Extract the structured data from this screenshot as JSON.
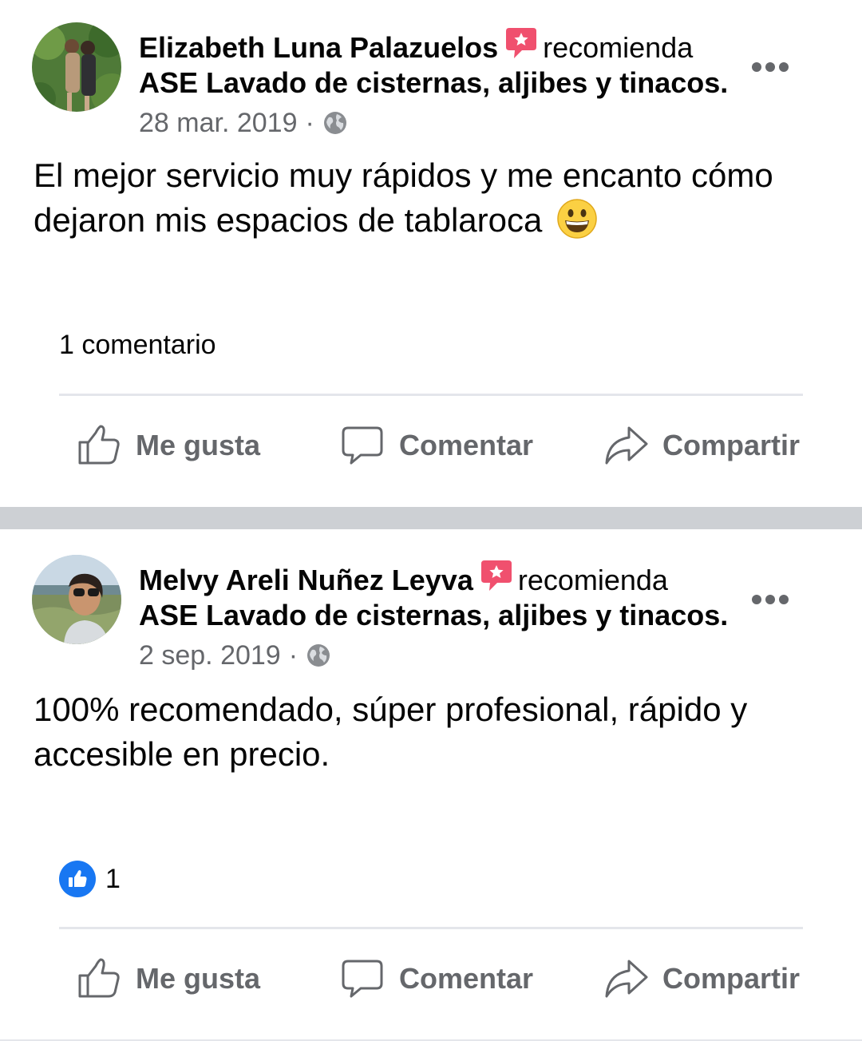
{
  "colors": {
    "recommend_icon": "#f0506e",
    "like_blue": "#1877f2",
    "secondary_text": "#65676b",
    "separator": "#cdd0d4"
  },
  "posts": [
    {
      "author": "Elizabeth Luna Palazuelos",
      "recommends_word": "recomienda",
      "page_name": "ASE Lavado de cisternas, aljibes y tinacos.",
      "date": "28 mar. 2019",
      "dot": "·",
      "privacy_icon": "globe-icon",
      "text": "El mejor servicio muy rápidos y me encanto cómo dejaron mis espacios de tablaroca",
      "emoji": "grinning-face-emoji",
      "stats": {
        "comments": "1 comentario"
      },
      "actions": {
        "like": "Me gusta",
        "comment": "Comentar",
        "share": "Compartir"
      }
    },
    {
      "author": "Melvy Areli Nuñez Leyva",
      "recommends_word": "recomienda",
      "page_name": "ASE Lavado de cisternas, aljibes y tinacos.",
      "date": "2 sep. 2019",
      "dot": "·",
      "privacy_icon": "globe-icon",
      "text": "100% recomendado, súper profesional, rápido y accesible en precio.",
      "stats": {
        "likes": "1"
      },
      "actions": {
        "like": "Me gusta",
        "comment": "Comentar",
        "share": "Compartir"
      }
    }
  ]
}
